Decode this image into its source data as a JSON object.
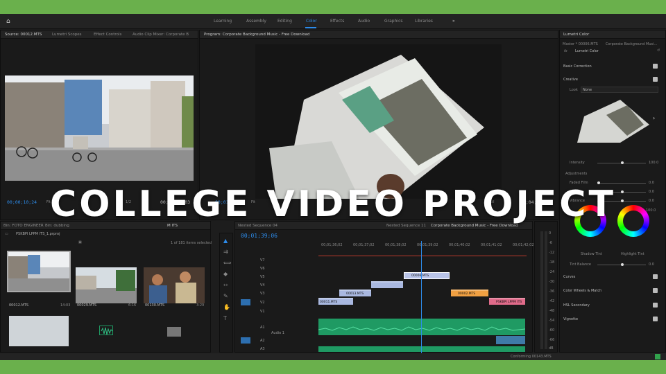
{
  "workspaces": [
    "Learning",
    "Assembly",
    "Editing",
    "Color",
    "Effects",
    "Audio",
    "Graphics",
    "Libraries"
  ],
  "active_workspace": "Color",
  "more_glyph": "»",
  "source_panel": {
    "tabs": [
      "Source: 00012.MTS",
      "Lumetri Scopes",
      "Effect Controls",
      "Audio Clip Mixer: Corporate B"
    ],
    "timecode_in": "00;00;10;24",
    "fit": "Fit",
    "scale": "1/2",
    "timecode_dur": "00;00;14;03"
  },
  "program_panel": {
    "title": "Program: Corporate Background Music - Free Download",
    "timecode_in": "00;01;39;06",
    "fit": "Fit",
    "scale": "Full",
    "timecode_dur": "00;04;22;15"
  },
  "project_panel": {
    "tabs": [
      "Bin: FOTO ENGINEER",
      "Bin: dubbing",
      "M ITS"
    ],
    "project_name": "PSKBPI LPPM ITS_1.prproj",
    "selection_count": "1 of 181 items selected",
    "items": [
      {
        "name": "00012.MTS",
        "duration": "14:03"
      },
      {
        "name": "00029.MTS",
        "duration": "6:16"
      },
      {
        "name": "00130.MTS",
        "duration": "3:29"
      }
    ]
  },
  "timeline": {
    "tab_left": "Nested Sequence 04",
    "tab_mid": "Nested Sequence 11",
    "tab_right": "Corporate Background Music - Free Download",
    "timecode": "00;01;39;06",
    "ruler": [
      "00;01;36;02",
      "00;01;37;02",
      "00;01;38;02",
      "00;01;39;02",
      "00;01;40;02",
      "00;01;41;02",
      "00;01;42;02"
    ],
    "video_tracks": [
      "V7",
      "V6",
      "V5",
      "V4",
      "V3",
      "V2",
      "V1"
    ],
    "audio_tracks": [
      "A1",
      "A2",
      "A3"
    ],
    "audio_track_name": "Audio 1",
    "clips": [
      {
        "label": "00006.MTS",
        "color": "#a9b8e0"
      },
      {
        "label": "",
        "color": "#a9b8e0"
      },
      {
        "label": "00002.MTS",
        "color": "#f0a042"
      },
      {
        "label": "00013.MTS",
        "color": "#a9b8e0"
      },
      {
        "label": "",
        "color": "#a9b8e0"
      },
      {
        "label": "00011.MTS",
        "color": "#a9b8e0"
      },
      {
        "label": "PSKBPI LPPM ITS",
        "color": "#e06b8a"
      }
    ],
    "meter_labels": [
      "0",
      "-6",
      "-12",
      "-18",
      "-24",
      "-30",
      "-36",
      "-42",
      "-48",
      "-54",
      "-60",
      "-66"
    ],
    "meter_db": "dB"
  },
  "lumetri": {
    "title": "Lumetri Color",
    "master": "Master * 00006.MTS",
    "sequence_clip": "Corporate Background Musi...",
    "fx_label": "fx",
    "effect_name": "Lumetri Color",
    "sections": [
      "Basic Correction",
      "Creative"
    ],
    "look_label": "Look",
    "look_value": "None",
    "intensity_label": "Intensity",
    "intensity_value": "100.0",
    "adjustments_label": "Adjustments",
    "adjustments": [
      {
        "label": "Faded Film",
        "value": "0.0"
      },
      {
        "label": "Sharpen",
        "value": "0.0"
      },
      {
        "label": "Vibrance",
        "value": "0.0"
      },
      {
        "label": "Saturation",
        "value": "100.0"
      }
    ],
    "wheel_labels": [
      "Shadow Tint",
      "Highlight Tint"
    ],
    "tint_balance_label": "Tint Balance",
    "tint_balance_value": "0.0",
    "more_sections": [
      "Curves",
      "Color Wheels & Match",
      "HSL Secondary",
      "Vignette"
    ]
  },
  "status_bar": "Conforming 00143.MTS",
  "overlay_title": "COLLEGE VIDEO PROJECT",
  "colors": {
    "accent": "#2d8ceb",
    "background_border": "#6ab04c",
    "audio_green": "#1f9a63"
  }
}
